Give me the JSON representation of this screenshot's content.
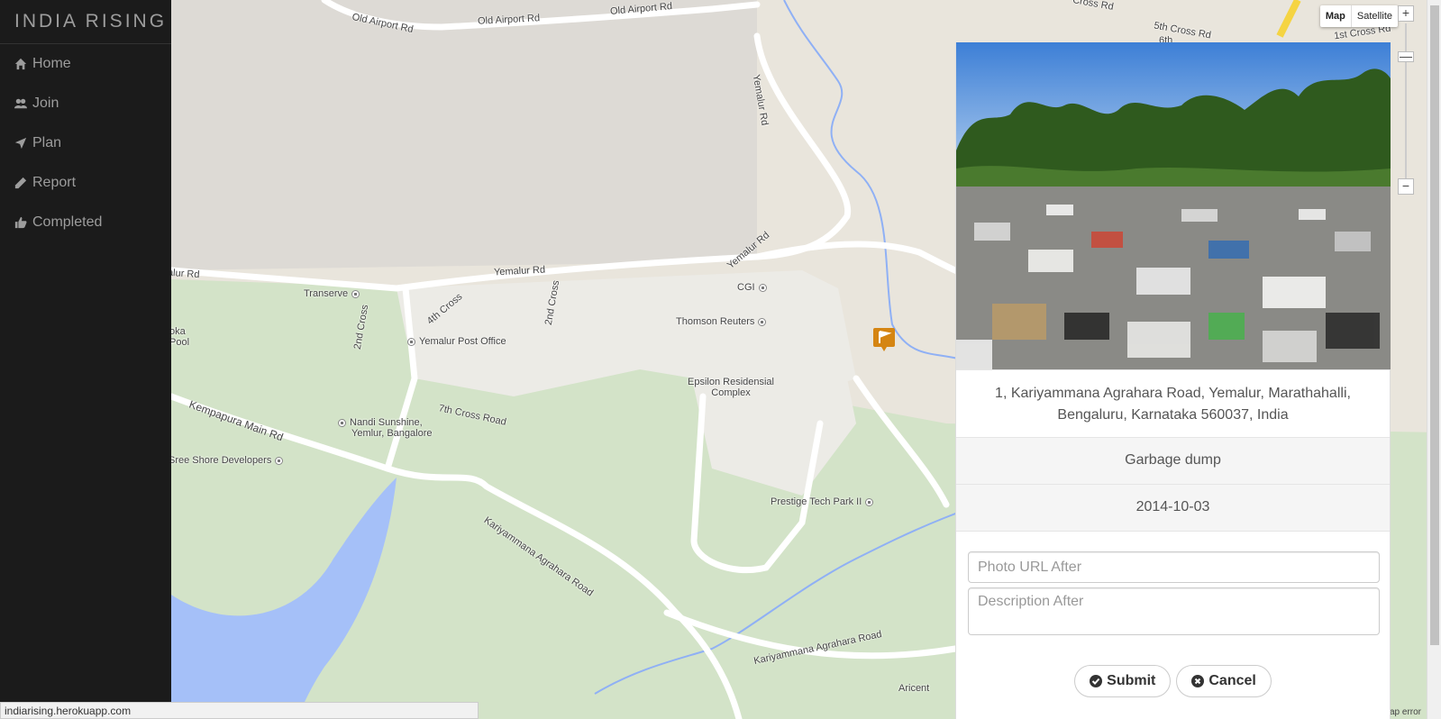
{
  "brand": "INDIA RISING",
  "nav": [
    {
      "label": "Home",
      "icon": "home-icon"
    },
    {
      "label": "Join",
      "icon": "users-icon"
    },
    {
      "label": "Plan",
      "icon": "location-arrow-icon"
    },
    {
      "label": "Report",
      "icon": "pencil-icon"
    },
    {
      "label": "Completed",
      "icon": "thumbs-up-icon"
    }
  ],
  "map": {
    "type_buttons": [
      "Map",
      "Satellite"
    ],
    "active_type": "Map",
    "zoom_in": "+",
    "zoom_out": "−",
    "error_text": "ap error",
    "labels": {
      "old_airport_rd_1": "Old Airport Rd",
      "old_airport_rd_2": "Old Airport Rd",
      "old_airport_rd_3": "Old Airport Rd",
      "yemalur_rd_1": "Yemalur Rd",
      "yemalur_rd_2": "Yemalur Rd",
      "yemalur_rd_3": "Yemalur Rd",
      "yemalur_rd_4": "alur Rd",
      "transerve": "Transerve",
      "cgi": "CGI",
      "thomson": "Thomson Reuters",
      "post_office": "Yemalur Post Office",
      "epsilon_1": "Epsilon Residensial",
      "epsilon_2": "Complex",
      "nandi_1": "Nandi Sunshine,",
      "nandi_2": "Yemlur, Bangalore",
      "sree_shore": "Sree Shore Developers",
      "prestige": "Prestige Tech Park II",
      "kempapura": "Kempapura Main Rd",
      "cross_7th": "7th Cross Road",
      "cross_2nd_a": "2nd Cross",
      "cross_2nd_b": "2nd Cross",
      "cross_4th": "4th Cross",
      "kariyammana_1": "Kariyammana Agrahara Road",
      "kariyammana_2": "Kariyammana Agrahara Road",
      "aricent": "Aricent",
      "pool_1": "oka",
      "pool_2": "Pool",
      "cross_5th": "5th Cross Rd",
      "cross_1st": "1st Cross Rd",
      "cross_top": "Cross Rd",
      "cross_6th": "6th"
    }
  },
  "report": {
    "address_line1": "1, Kariyammana Agrahara Road, Yemalur, Marathahalli,",
    "address_line2": "Bengaluru, Karnataka 560037, India",
    "category": "Garbage dump",
    "date": "2014-10-03",
    "photo_placeholder": "Photo URL After",
    "description_placeholder": "Description After",
    "submit_label": "Submit",
    "cancel_label": "Cancel"
  },
  "status_url": "indiarising.herokuapp.com",
  "colors": {
    "sidebar_bg": "#1b1b1b",
    "marker": "#d58512",
    "water": "#a5c0f8",
    "park": "#d3e3c8"
  }
}
